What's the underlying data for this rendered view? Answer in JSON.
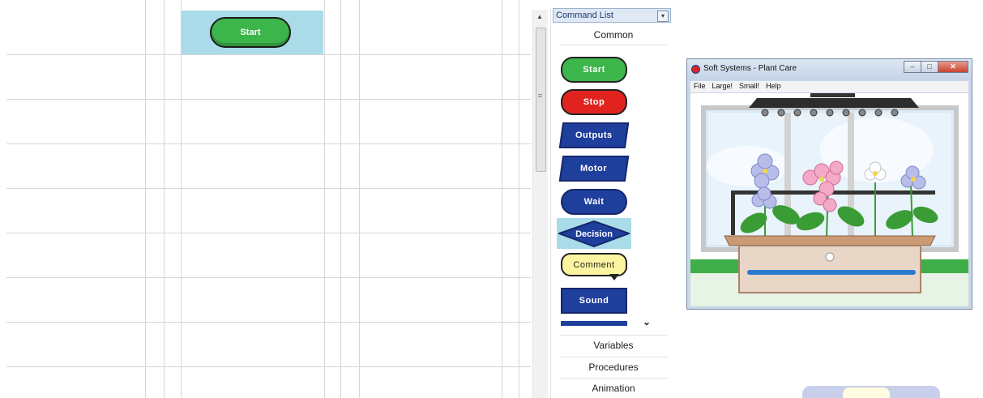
{
  "canvas": {
    "start_block_label": "Start"
  },
  "command_list": {
    "title": "Command List",
    "common_header": "Common",
    "blocks": [
      {
        "label": "Start",
        "shape": "pill",
        "color": "#3cb54a"
      },
      {
        "label": "Stop",
        "shape": "pill",
        "color": "#e0231f"
      },
      {
        "label": "Outputs",
        "shape": "parallelogram",
        "color": "#1f3f9c"
      },
      {
        "label": "Motor",
        "shape": "parallelogram",
        "color": "#1f3f9c"
      },
      {
        "label": "Wait",
        "shape": "pill",
        "color": "#1f3f9c"
      },
      {
        "label": "Decision",
        "shape": "diamond",
        "color": "#1f3f9c"
      },
      {
        "label": "Comment",
        "shape": "speech-bubble",
        "color": "#fbf5a0"
      },
      {
        "label": "Sound",
        "shape": "rect",
        "color": "#1f3f9c"
      }
    ],
    "sections": [
      "Variables",
      "Procedures",
      "Animation"
    ]
  },
  "plant_window": {
    "title": "Soft Systems - Plant Care",
    "menu": [
      "File",
      "Large!",
      "Small!",
      "Help"
    ],
    "controls": [
      "minimize",
      "maximize",
      "close"
    ]
  },
  "icons": {
    "scroll_up": "arrow-up-icon",
    "scroll_grip": "grip-icon",
    "more": "chevron-down-icon",
    "panel_dropdown": "dropdown-icon",
    "app": "app-logo-icon"
  }
}
